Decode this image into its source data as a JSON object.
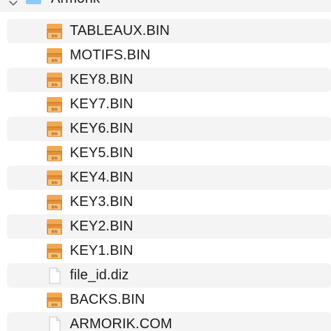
{
  "folder": {
    "name": "Armorik",
    "icon": "folder-icon",
    "expanded": true
  },
  "files": [
    {
      "name": "TABLEAUX.BIN",
      "icon": "bin-file-icon"
    },
    {
      "name": "MOTIFS.BIN",
      "icon": "bin-file-icon"
    },
    {
      "name": "KEY8.BIN",
      "icon": "bin-file-icon"
    },
    {
      "name": "KEY7.BIN",
      "icon": "bin-file-icon"
    },
    {
      "name": "KEY6.BIN",
      "icon": "bin-file-icon"
    },
    {
      "name": "KEY5.BIN",
      "icon": "bin-file-icon"
    },
    {
      "name": "KEY4.BIN",
      "icon": "bin-file-icon"
    },
    {
      "name": "KEY3.BIN",
      "icon": "bin-file-icon"
    },
    {
      "name": "KEY2.BIN",
      "icon": "bin-file-icon"
    },
    {
      "name": "KEY1.BIN",
      "icon": "bin-file-icon"
    },
    {
      "name": "file_id.diz",
      "icon": "document-icon"
    },
    {
      "name": "BACKS.BIN",
      "icon": "bin-file-icon"
    },
    {
      "name": "ARMORIK.COM",
      "icon": "document-icon"
    }
  ],
  "colors": {
    "row_alt": "#f4f4f5",
    "folder_blue": "#5aaef0",
    "bin_orange": "#e89a3c",
    "text": "#1d1d1f"
  }
}
